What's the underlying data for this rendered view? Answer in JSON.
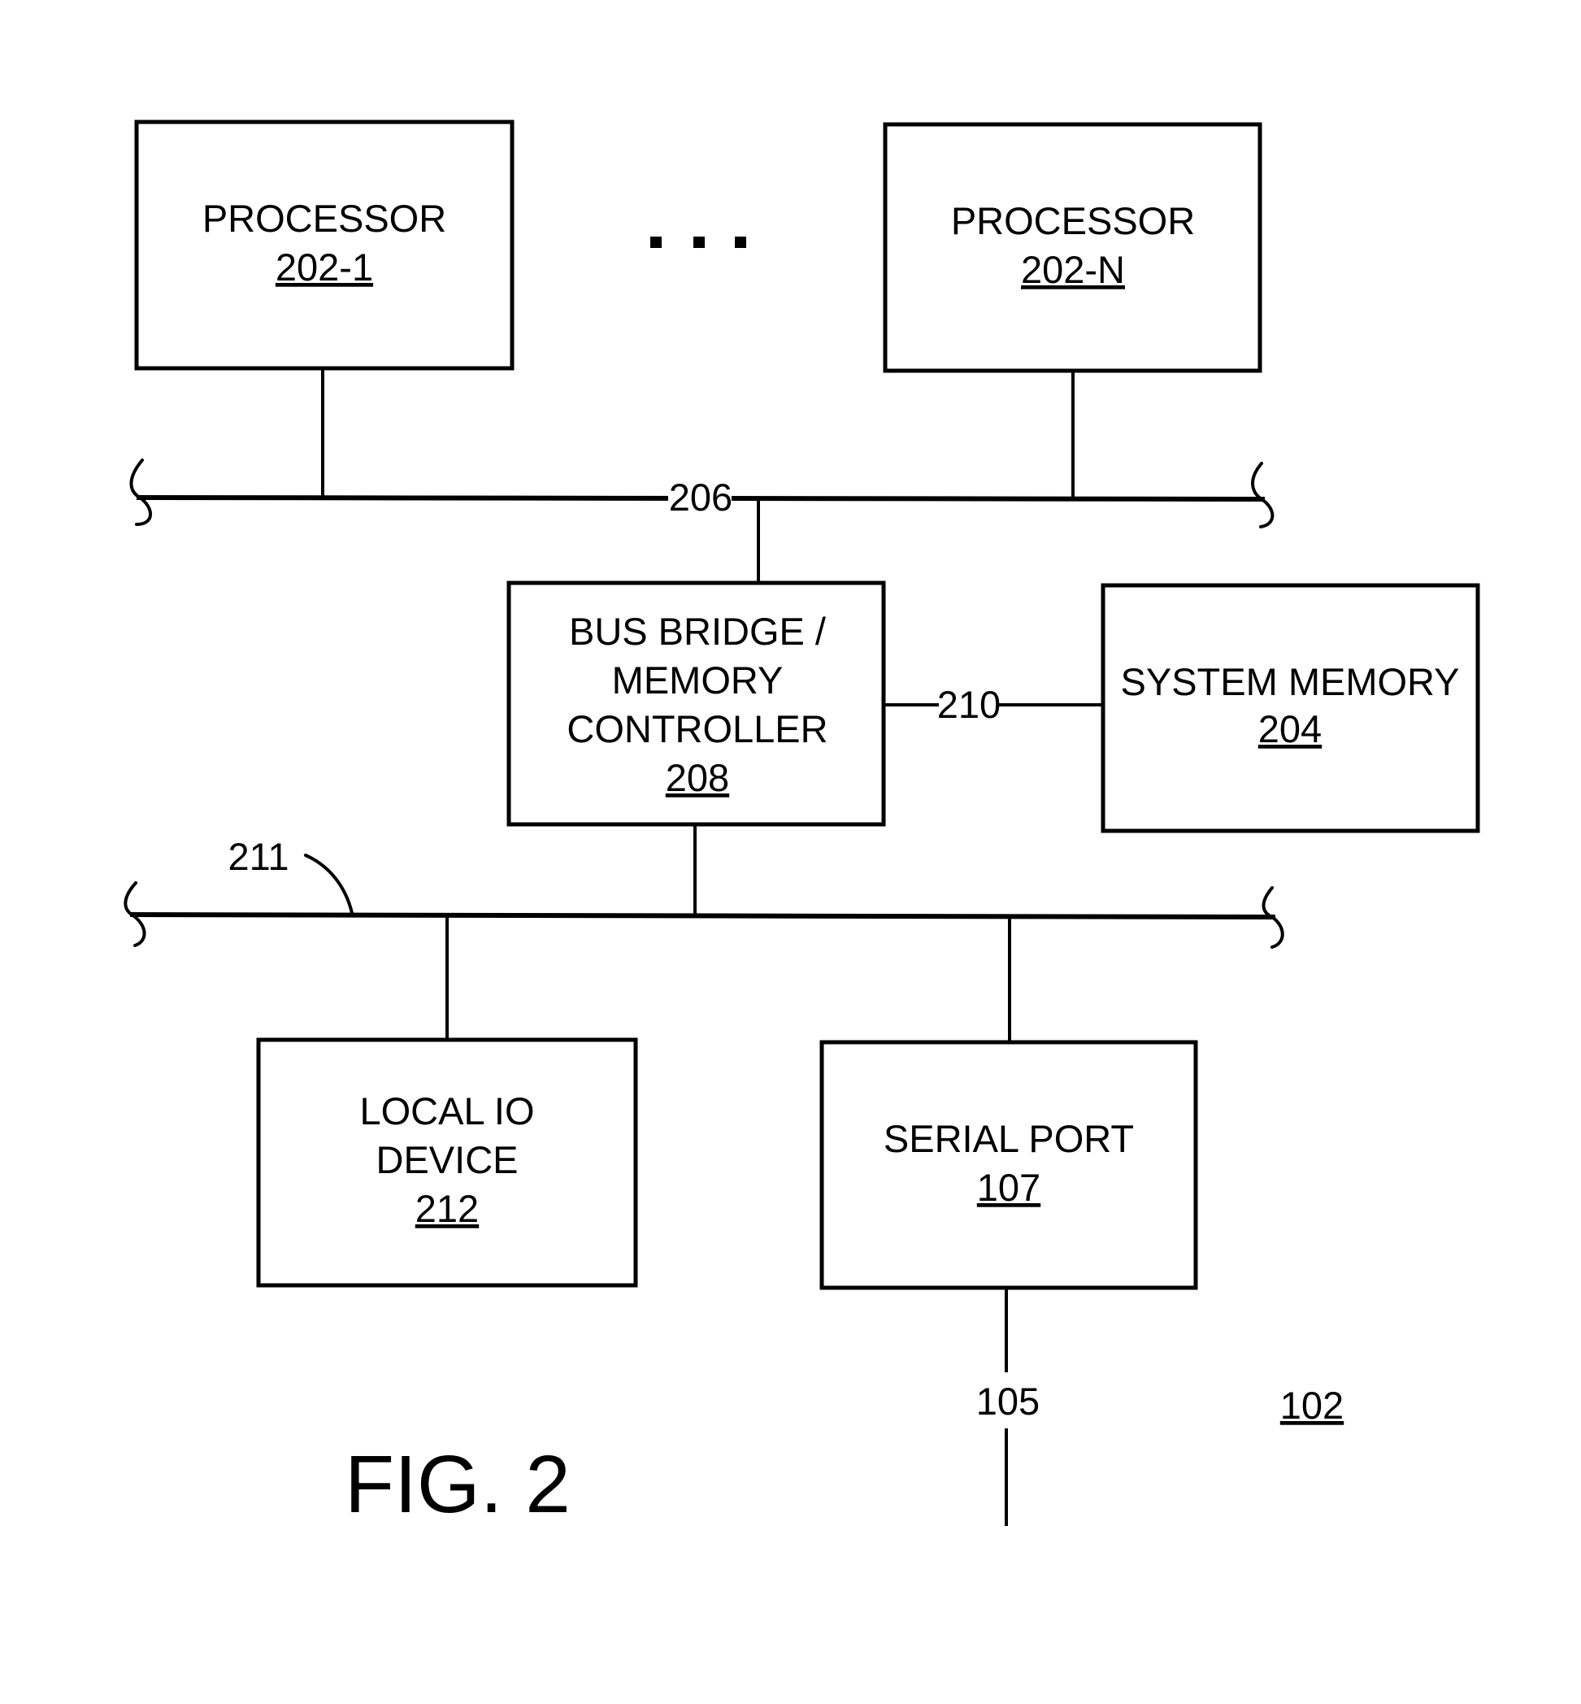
{
  "figure": {
    "title": "FIG. 2",
    "reference": "102"
  },
  "blocks": {
    "processor_1": {
      "label": "PROCESSOR",
      "ref": "202-1"
    },
    "processor_n": {
      "label": "PROCESSOR",
      "ref": "202-N"
    },
    "bus_bridge": {
      "lines": [
        "BUS BRIDGE /",
        "MEMORY",
        "CONTROLLER"
      ],
      "ref": "208"
    },
    "system_memory": {
      "label": "SYSTEM MEMORY",
      "ref": "204"
    },
    "local_io": {
      "lines": [
        "LOCAL IO",
        "DEVICE"
      ],
      "ref": "212"
    },
    "serial_port": {
      "label": "SERIAL PORT",
      "ref": "107"
    }
  },
  "connections": {
    "processor_bus": "206",
    "memory_bus": "210",
    "io_bus": "211",
    "serial_link": "105"
  },
  "ellipsis": "..."
}
